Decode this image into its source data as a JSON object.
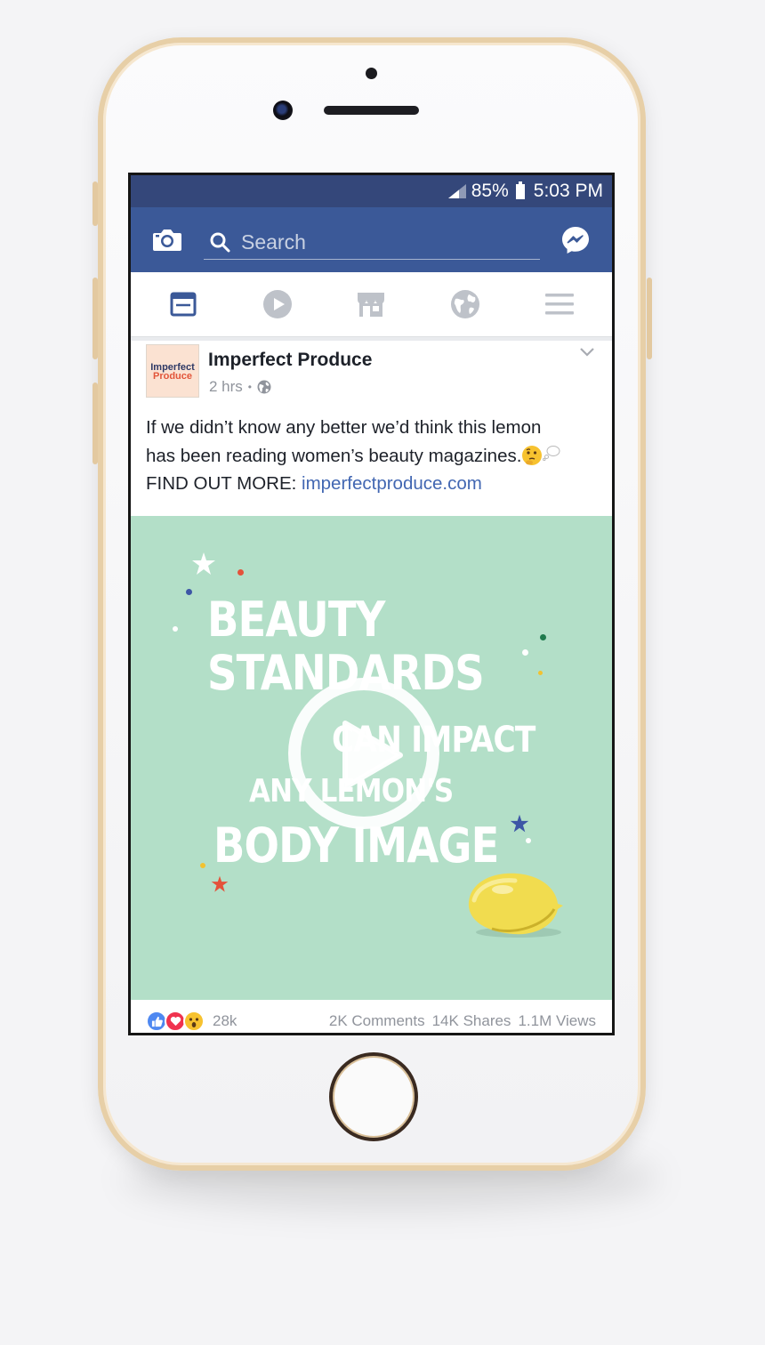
{
  "status_bar": {
    "battery": "85%",
    "time": "5:03 PM"
  },
  "search": {
    "placeholder": "Search"
  },
  "post": {
    "page_logo": {
      "line1": "Imperfect",
      "line2": "Produce"
    },
    "page_name": "Imperfect Produce",
    "time": "2 hrs",
    "separator": "•",
    "text_line1": "If we didn’t know any better we’d think this lemon",
    "text_line2": "has been reading women’s beauty magazines.",
    "text_line3_prefix": "FIND OUT MORE: ",
    "link": "imperfectproduce.com"
  },
  "video": {
    "line1": "BEAUTY",
    "line2": "STANDARDS",
    "line3": "CAN IMPACT",
    "line4": "ANY LEMON'S",
    "line5": "BODY IMAGE"
  },
  "footer": {
    "reaction_count": "28k",
    "comments": "2K Comments",
    "shares": "14K Shares",
    "views": "1.1M Views"
  },
  "colors": {
    "facebook_blue": "#3b5998",
    "status_bar": "#34477a",
    "video_bg": "#b3dfc8",
    "link": "#4267b2"
  },
  "icons": [
    "camera-icon",
    "search-icon",
    "messenger-icon",
    "news-feed-icon",
    "video-icon",
    "marketplace-icon",
    "notifications-globe-icon",
    "menu-icon",
    "chevron-down-icon",
    "globe-icon",
    "play-icon",
    "like-icon",
    "love-icon",
    "wow-icon"
  ]
}
